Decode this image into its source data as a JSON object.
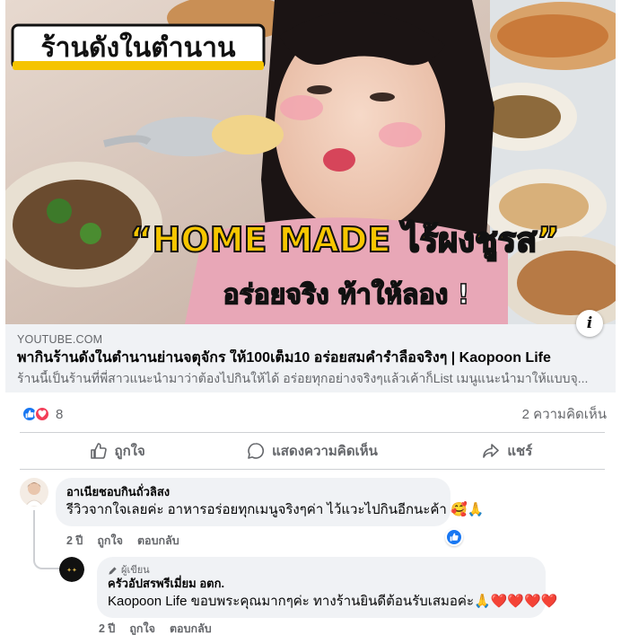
{
  "post": {
    "thumbnail": {
      "headline_text": "ร้านดังในตำนาน",
      "banner_text": "“HOME MADE ไร้ผงชูรส”",
      "subtext": "อร่อยจริง ท้าให้ลอง !",
      "info_label": "i"
    },
    "link": {
      "domain": "YOUTUBE.COM",
      "title": "พากินร้านดังในตำนานย่านจตุจักร ให้100เต็ม10 อร่อยสมคำร่ำลือจริงๆ | Kaopoon Life",
      "description": "ร้านนี้เป็นร้านที่พี่สาวแนะนำมาว่าต้องไปกินให้ได้ อร่อยทุกอย่างจริงๆแล้วเค้าก็List เมนูแนะนำมาให้แบบจุ..."
    },
    "reactions": {
      "count": "8",
      "comments_label": "2 ความคิดเห็น",
      "icons": [
        "like-icon",
        "love-icon"
      ],
      "like_color": "#1877f2",
      "love_color": "#f33e58"
    },
    "actions": {
      "like": "ถูกใจ",
      "comment": "แสดงความคิดเห็น",
      "share": "แชร์"
    }
  },
  "comments": [
    {
      "name": "อาเนียชอบกินถั่วลิสง",
      "text": "รีวิวจากใจเลยค่ะ อาหารอร่อยทุกเมนูจริงๆค่า ไว้แวะไปกินอีกนะค้า 🥰🙏",
      "time": "2 ปี",
      "like": "ถูกใจ",
      "reply": "ตอบกลับ",
      "reaction_icon": "like-icon"
    },
    {
      "author_tag": "ผู้เขียน",
      "name": "ครัวอัปสรพรีเมี่ยม อตก.",
      "text": "Kaopoon Life ขอบพระคุณมากๆค่ะ ทางร้านยินดีต้อนรับเสมอค่ะ🙏❤️❤️❤️❤️",
      "time": "2 ปี",
      "like": "ถูกใจ",
      "reply": "ตอบกลับ"
    }
  ]
}
